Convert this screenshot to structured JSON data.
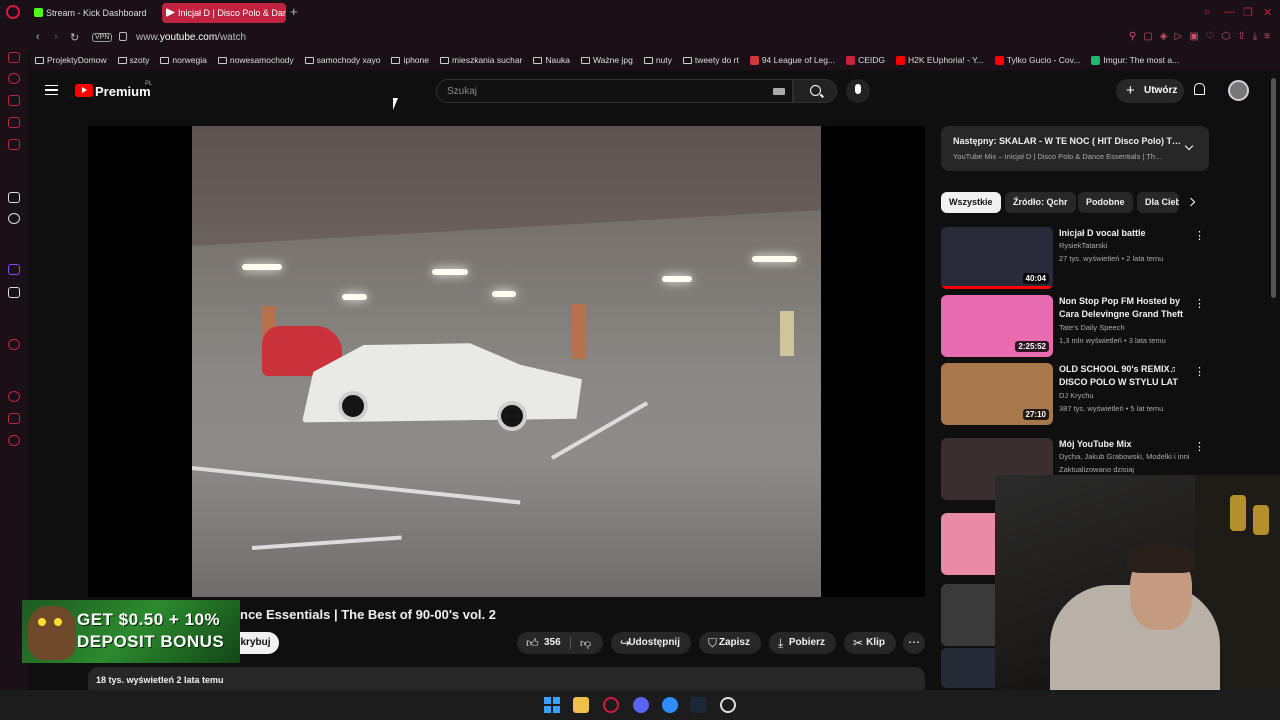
{
  "browser": {
    "tabs": [
      {
        "label": "Stream - Kick Dashboard"
      },
      {
        "label": "Inicjał D | Disco Polo & Dance Essentials"
      }
    ],
    "url_prefix": "www.",
    "url_domain": "youtube.com",
    "url_path": "/watch",
    "vpn_label": "VPN",
    "bookmarks": [
      {
        "label": "ProjektyDomow",
        "kind": "folder"
      },
      {
        "label": "szoty",
        "kind": "folder"
      },
      {
        "label": "norwegia",
        "kind": "folder"
      },
      {
        "label": "nowesamochody",
        "kind": "folder"
      },
      {
        "label": "samochody xayo",
        "kind": "folder"
      },
      {
        "label": "iphone",
        "kind": "folder"
      },
      {
        "label": "mieszkania suchar",
        "kind": "folder"
      },
      {
        "label": "Nauka",
        "kind": "folder"
      },
      {
        "label": "Ważne jpg",
        "kind": "folder"
      },
      {
        "label": "nuty",
        "kind": "folder"
      },
      {
        "label": "tweety do rt",
        "kind": "folder"
      },
      {
        "label": "94 League of Leg...",
        "kind": "site",
        "color": "#d13639"
      },
      {
        "label": "CEIDG",
        "kind": "site",
        "color": "#c4233a"
      },
      {
        "label": "H2K EUphoria! - Y...",
        "kind": "site",
        "color": "#ff0000"
      },
      {
        "label": "Tylko Gucio - Cov...",
        "kind": "site",
        "color": "#ff0000"
      },
      {
        "label": "Imgur: The most a...",
        "kind": "site",
        "color": "#1bb76e"
      }
    ]
  },
  "youtube": {
    "brand": "Premium",
    "region": "PL",
    "search_placeholder": "Szukaj",
    "create_label": "Utwórz",
    "video": {
      "title_visible": "nce Essentials | The Best of 90-00's vol. 2",
      "subscribe_visible": "krybuj",
      "likes": "356",
      "share_label": "Udostępnij",
      "save_label": "Zapisz",
      "download_label": "Pobierz",
      "clip_label": "Klip",
      "views_date": "18 tys. wyświetleń  2 lata temu"
    },
    "up_next": {
      "title": "Następny: SKALAR - W TE NOC ( HIT Disco Polo) Ti...",
      "subtitle": "YouTube Mix – Inicjał D | Disco Polo & Dance Essentials | Th..."
    },
    "chips": [
      {
        "label": "Wszystkie",
        "active": true
      },
      {
        "label": "Źródło: Qchr",
        "active": false
      },
      {
        "label": "Podobne",
        "active": false
      },
      {
        "label": "Dla Ciebie",
        "active": false
      }
    ],
    "recommendations": [
      {
        "title": "Inicjał D vocal battle",
        "channel": "RysiekTatarski",
        "meta": "27 tys. wyświetleń • 2 lata temu",
        "duration": "40:04",
        "thumb_color": "#2a2a3a",
        "progress": 1.0
      },
      {
        "title": "Non Stop Pop FM Hosted by Cara Delevingne Grand Theft ...",
        "channel": "Tate's Daily Speech",
        "meta": "1,3 mln wyświetleń • 3 lata temu",
        "duration": "2:25:52",
        "thumb_color": "#e86bb0",
        "progress": 0.0
      },
      {
        "title": "OLD SCHOOL 90's REMIX♫ DISCO POLO W STYLU LAT 90...",
        "channel": "DJ Krychu",
        "meta": "387 tys. wyświetleń • 5 lat temu",
        "duration": "27:10",
        "thumb_color": "#a8784c",
        "progress": 0.0
      },
      {
        "title": "Mój YouTube Mix",
        "channel": "Dycha, Jakub Grabowski, Modelki i inni",
        "meta": "Zaktualizowano dzisiaj",
        "duration": "",
        "thumb_color": "#3a2e30",
        "progress": 0.0
      }
    ]
  },
  "ad": {
    "line1": "GET $0.50 + 10%",
    "line2": "DEPOSIT BONUS"
  },
  "colors": {
    "accent": "#ff0000",
    "opera": "#d3193c",
    "background": "#0f0f0f",
    "surface": "#272727"
  }
}
